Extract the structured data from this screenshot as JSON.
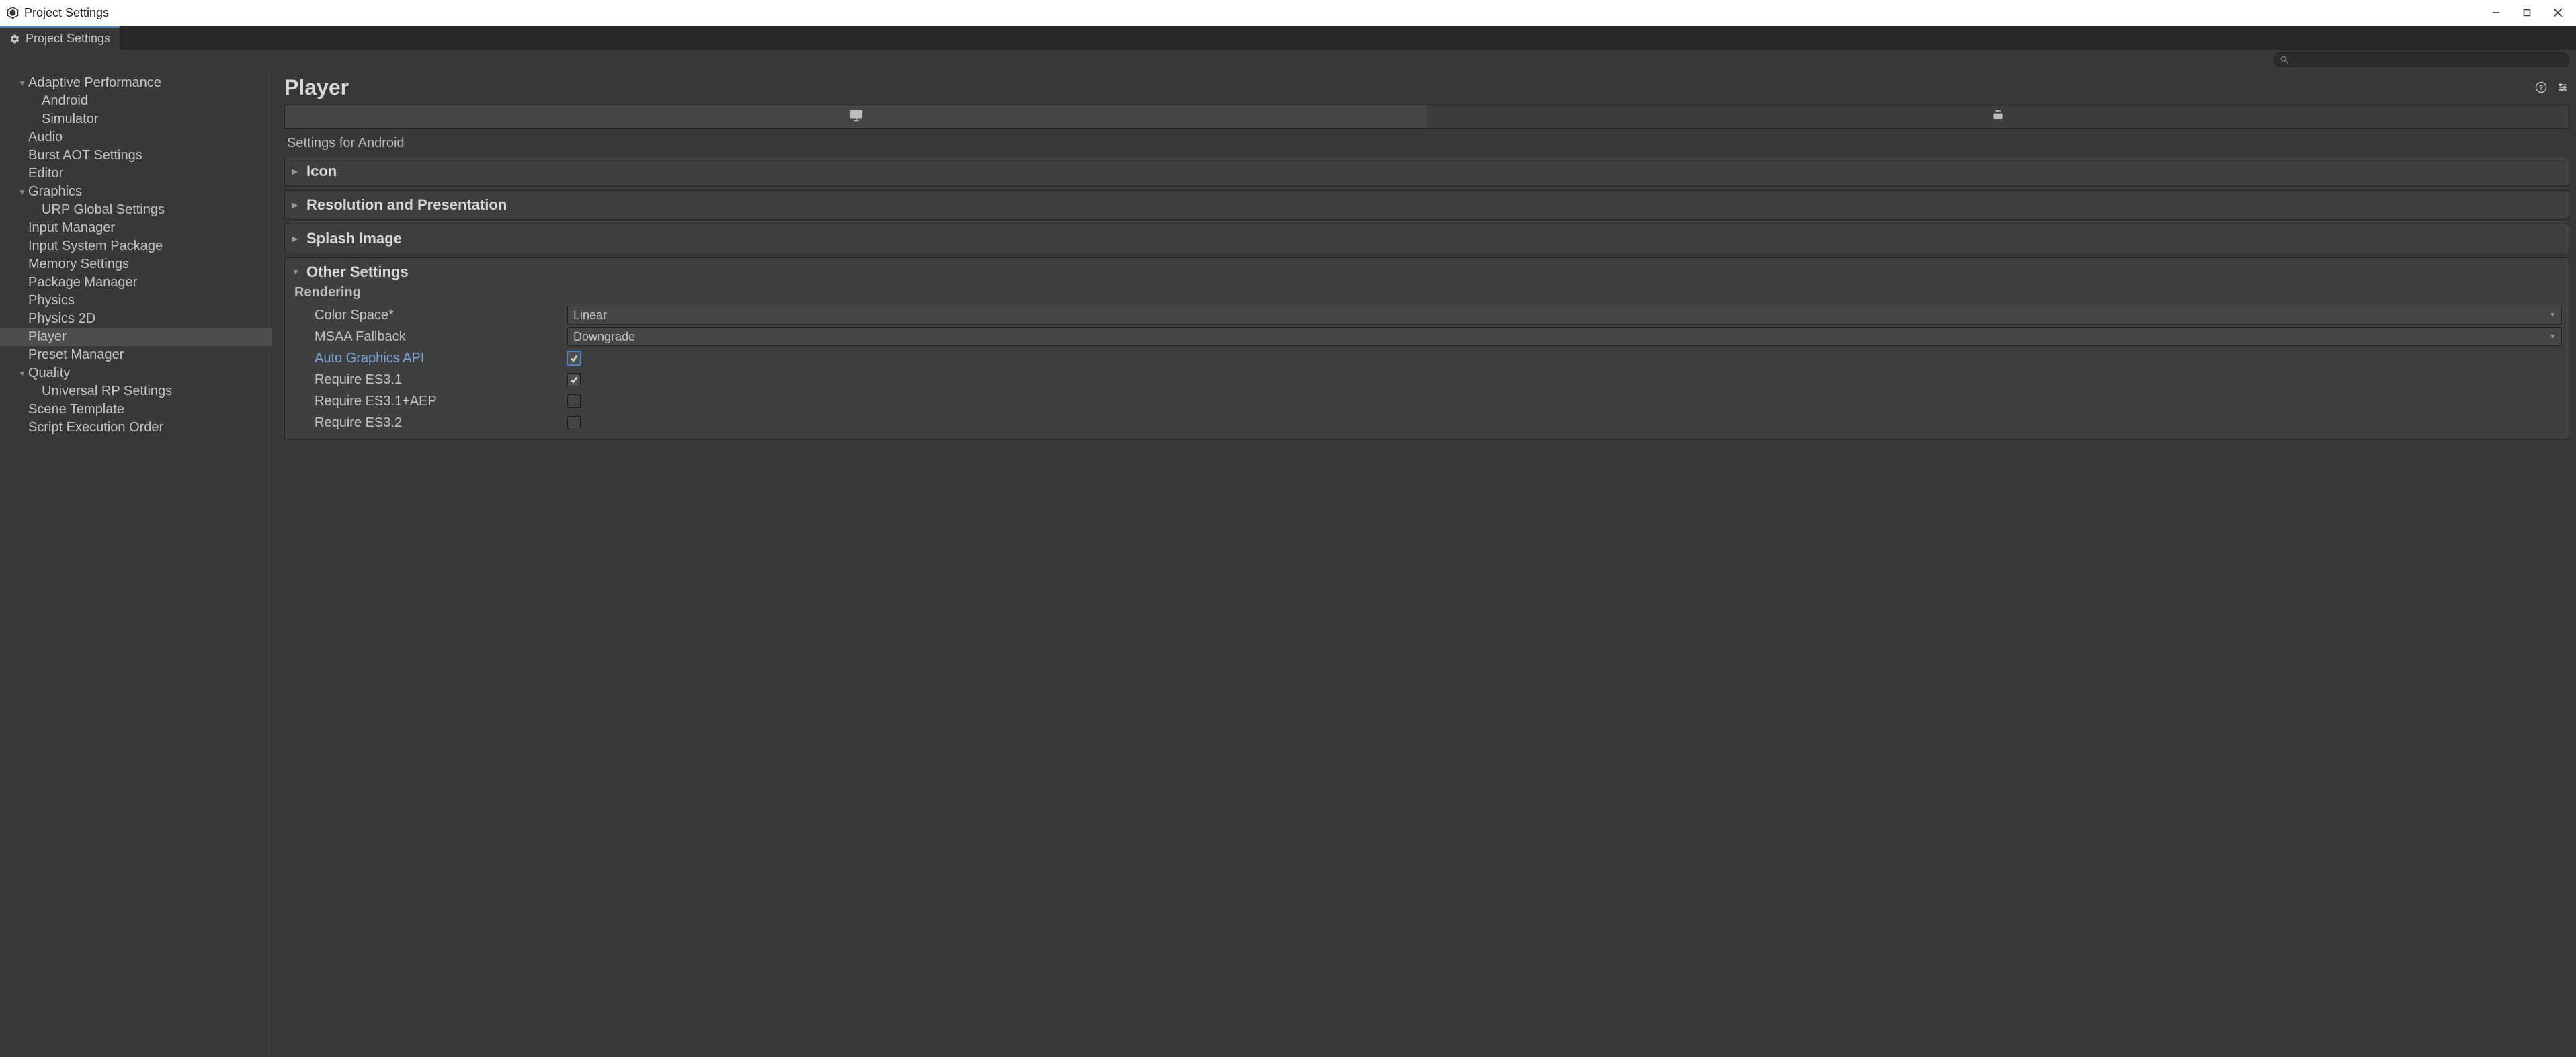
{
  "window": {
    "title": "Project Settings"
  },
  "tab": {
    "label": "Project Settings"
  },
  "search": {
    "value": "",
    "placeholder": ""
  },
  "sidebar": {
    "items": [
      {
        "label": "Adaptive Performance",
        "indent": 1,
        "caret": "down"
      },
      {
        "label": "Android",
        "indent": 2,
        "caret": "none"
      },
      {
        "label": "Simulator",
        "indent": 2,
        "caret": "none"
      },
      {
        "label": "Audio",
        "indent": 1,
        "caret": "none"
      },
      {
        "label": "Burst AOT Settings",
        "indent": 1,
        "caret": "none"
      },
      {
        "label": "Editor",
        "indent": 1,
        "caret": "none"
      },
      {
        "label": "Graphics",
        "indent": 1,
        "caret": "down"
      },
      {
        "label": "URP Global Settings",
        "indent": 2,
        "caret": "none"
      },
      {
        "label": "Input Manager",
        "indent": 1,
        "caret": "none"
      },
      {
        "label": "Input System Package",
        "indent": 1,
        "caret": "none"
      },
      {
        "label": "Memory Settings",
        "indent": 1,
        "caret": "none"
      },
      {
        "label": "Package Manager",
        "indent": 1,
        "caret": "none"
      },
      {
        "label": "Physics",
        "indent": 1,
        "caret": "none"
      },
      {
        "label": "Physics 2D",
        "indent": 1,
        "caret": "none"
      },
      {
        "label": "Player",
        "indent": 1,
        "caret": "none",
        "selected": true
      },
      {
        "label": "Preset Manager",
        "indent": 1,
        "caret": "none"
      },
      {
        "label": "Quality",
        "indent": 1,
        "caret": "down"
      },
      {
        "label": "Universal RP Settings",
        "indent": 2,
        "caret": "none"
      },
      {
        "label": "Scene Template",
        "indent": 1,
        "caret": "none"
      },
      {
        "label": "Script Execution Order",
        "indent": 1,
        "caret": "none"
      }
    ]
  },
  "main": {
    "title": "Player",
    "section_label": "Settings for Android",
    "foldouts": {
      "icon": "Icon",
      "resolution": "Resolution and Presentation",
      "splash": "Splash Image",
      "other": "Other Settings"
    },
    "rendering": {
      "heading": "Rendering",
      "color_space": {
        "label": "Color Space*",
        "value": "Linear"
      },
      "msaa_fallback": {
        "label": "MSAA Fallback",
        "value": "Downgrade"
      },
      "auto_graphics_api": {
        "label": "Auto Graphics API",
        "checked": true
      },
      "require_es31": {
        "label": "Require ES3.1",
        "checked": true
      },
      "require_es31aep": {
        "label": "Require ES3.1+AEP",
        "checked": false
      },
      "require_es32": {
        "label": "Require ES3.2",
        "checked": false
      }
    }
  }
}
